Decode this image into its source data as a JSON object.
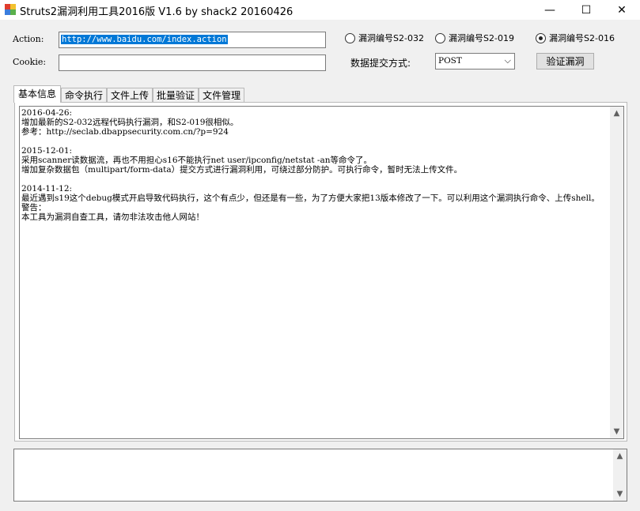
{
  "window": {
    "title": "Struts2漏洞利用工具2016版 V1.6 by shack2  20160426",
    "minimize_glyph": "—",
    "maximize_glyph": "☐",
    "close_glyph": "✕"
  },
  "form": {
    "action_label": "Action:",
    "action_value": "http://www.baidu.com/index.action",
    "cookie_label": "Cookie:",
    "cookie_value": "",
    "method_label": "数据提交方式:",
    "method_value": "POST",
    "verify_button": "验证漏洞"
  },
  "vulns": [
    {
      "label": "漏洞编号S2-032",
      "checked": false
    },
    {
      "label": "漏洞编号S2-019",
      "checked": false
    },
    {
      "label": "漏洞编号S2-016",
      "checked": true
    }
  ],
  "tabs": [
    {
      "label": "基本信息",
      "active": true
    },
    {
      "label": "命令执行",
      "active": false
    },
    {
      "label": "文件上传",
      "active": false
    },
    {
      "label": "批量验证",
      "active": false
    },
    {
      "label": "文件管理",
      "active": false
    }
  ],
  "log_lines": [
    "2016-04-26:",
    "增加最新的S2-032远程代码执行漏洞，和S2-019很相似。",
    "参考：http://seclab.dbappsecurity.com.cn/?p=924",
    "",
    "2015-12-01:",
    "采用scanner读数据流，再也不用担心s16不能执行net user/ipconfig/netstat -an等命令了。",
    "增加复杂数据包（multipart/form-data）提交方式进行漏洞利用，可绕过部分防护。可执行命令，暂时无法上传文件。",
    "",
    "2014-11-12:",
    "最近遇到s19这个debug模式开启导致代码执行，这个有点少，但还是有一些，为了方便大家把13版本修改了一下。可以利用这个漏洞执行命令、上传shell。",
    "警告：",
    "本工具为漏洞自查工具，请勿非法攻击他人网站！"
  ],
  "scroll": {
    "up": "▲",
    "down": "▼"
  },
  "select_arrow": "⌵"
}
